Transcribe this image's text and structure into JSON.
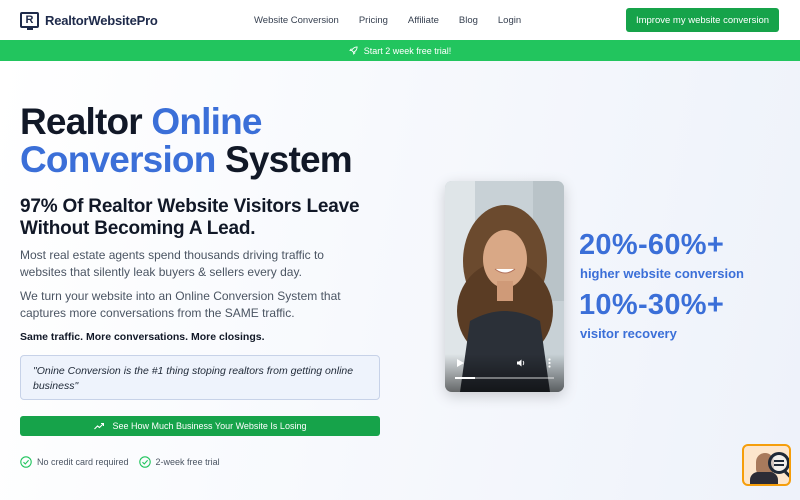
{
  "nav": {
    "logo_letter": "R",
    "logo_text": "RealtorWebsitePro",
    "links": [
      "Website Conversion",
      "Pricing",
      "Affiliate",
      "Blog",
      "Login"
    ],
    "cta_label": "Improve my website conversion"
  },
  "banner": {
    "icon": "rocket-icon",
    "text": "Start 2 week free trial!"
  },
  "hero": {
    "headline_1": "Realtor ",
    "headline_blue_1": "Online",
    "headline_blue_2": "Conversion",
    "headline_2": " System",
    "subheadline": "97% Of Realtor Website Visitors Leave Without Becoming A Lead.",
    "paragraph_1": "Most real estate agents spend thousands driving traffic to websites that silently leak buyers & sellers every day.",
    "paragraph_2": "We turn your website into an Online Conversion System that captures more conversations from the SAME traffic.",
    "tagline": "Same traffic. More conversations. More closings.",
    "quote": "\"Onine Conversion is the #1 thing stoping realtors from getting online business\"",
    "cta_label": "See How Much Business Your Website Is Losing",
    "checks": [
      "No credit card required",
      "2-week free trial"
    ]
  },
  "video": {
    "progress": 0.2
  },
  "stats": [
    {
      "value": "20%-60%+",
      "label": "higher website conversion"
    },
    {
      "value": "10%-30%+",
      "label": "visitor recovery"
    }
  ],
  "colors": {
    "accent_blue": "#3b6fd8",
    "cta_green": "#16a34a",
    "banner_green": "#22c55e"
  }
}
